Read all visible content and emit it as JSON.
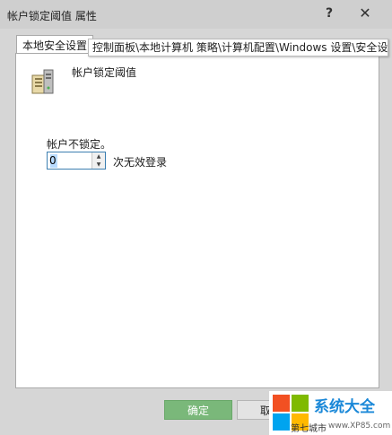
{
  "window": {
    "title": "帐户锁定阈值 属性"
  },
  "titlebar": {
    "help_glyph": "?",
    "close_glyph": "✕"
  },
  "tabs": [
    {
      "label": "本地安全设置"
    }
  ],
  "tooltip": {
    "text": "控制面板\\本地计算机 策略\\计算机配置\\Windows 设置\\安全设置"
  },
  "policy": {
    "title": "帐户锁定阈值",
    "icon": "server-policy-icon"
  },
  "threshold": {
    "caption": "帐户不锁定。",
    "value": "0",
    "unit": "次无效登录"
  },
  "buttons": {
    "ok": "确定",
    "cancel": "取消"
  },
  "watermark": {
    "brand": "系统大全",
    "sub": "第七城市",
    "url": "www.XP85.com"
  },
  "colors": {
    "ok_button": "#7ab87a",
    "focus_border": "#3c7fb1",
    "brand": "#1a88d8"
  }
}
